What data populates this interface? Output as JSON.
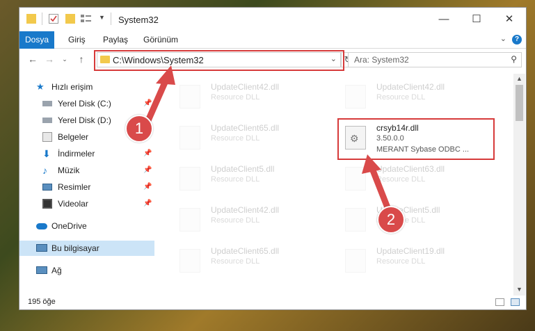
{
  "window": {
    "title": "System32"
  },
  "ribbon": {
    "tabs": [
      "Dosya",
      "Giriş",
      "Paylaş",
      "Görünüm"
    ],
    "help": "?"
  },
  "nav": {
    "address": "C:\\Windows\\System32",
    "search_placeholder": "Ara: System32"
  },
  "sidebar": {
    "items": [
      {
        "label": "Hızlı erişim",
        "icon": "star-icon"
      },
      {
        "label": "Yerel Disk (C:)",
        "icon": "drive-icon"
      },
      {
        "label": "Yerel Disk (D:)",
        "icon": "drive-icon"
      },
      {
        "label": "Belgeler",
        "icon": "documents-icon"
      },
      {
        "label": "İndirmeler",
        "icon": "download-icon"
      },
      {
        "label": "Müzik",
        "icon": "music-icon"
      },
      {
        "label": "Resimler",
        "icon": "pictures-icon"
      },
      {
        "label": "Videolar",
        "icon": "video-icon"
      },
      {
        "label": "OneDrive",
        "icon": "cloud-icon"
      },
      {
        "label": "Bu bilgisayar",
        "icon": "computer-icon"
      },
      {
        "label": "Ağ",
        "icon": "network-icon"
      }
    ]
  },
  "files": [
    {
      "name": "UpdateClient42.dll",
      "desc": "Resource DLL"
    },
    {
      "name": "UpdateClient42.dll",
      "desc": "Resource DLL"
    },
    {
      "name": "UpdateClient65.dll",
      "desc": "Resource DLL"
    },
    {
      "name": "crsyb14r.dll",
      "version": "3.50.0.0",
      "desc": "MERANT Sybase ODBC ..."
    },
    {
      "name": "UpdateClient5.dll",
      "desc": "Resource DLL"
    },
    {
      "name": "UpdateClient63.dll",
      "desc": "Resource DLL"
    },
    {
      "name": "UpdateClient42.dll",
      "desc": "Resource DLL"
    },
    {
      "name": "UpdateClient5.dll",
      "desc": "Resource DLL"
    },
    {
      "name": "UpdateClient65.dll",
      "desc": "Resource DLL"
    },
    {
      "name": "UpdateClient19.dll",
      "desc": "Resource DLL"
    }
  ],
  "status": {
    "count": "195 öğe"
  },
  "annotations": {
    "step1": "1",
    "step2": "2",
    "color": "#d94a4a"
  }
}
